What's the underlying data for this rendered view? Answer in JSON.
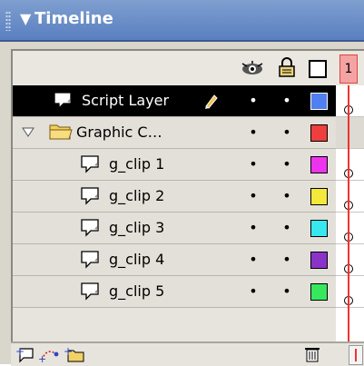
{
  "panel": {
    "title": "Timeline"
  },
  "header": {
    "frame_number": "1"
  },
  "layers": [
    {
      "name": "Script Layer",
      "type": "layer",
      "selected": true,
      "color": "#4f7ff0",
      "has_pencil": true,
      "indent": 1,
      "keyframe": "hollow"
    },
    {
      "name": "Graphic C…",
      "type": "folder",
      "expanded": true,
      "color": "#ee3e3e",
      "indent": 0,
      "keyframe": "none"
    },
    {
      "name": "g_clip 1",
      "type": "layer",
      "color": "#ee33ee",
      "indent": 2,
      "keyframe": "hollow"
    },
    {
      "name": "g_clip 2",
      "type": "layer",
      "color": "#f4e83a",
      "indent": 2,
      "keyframe": "hollow"
    },
    {
      "name": "g_clip 3",
      "type": "layer",
      "color": "#38e8ef",
      "indent": 2,
      "keyframe": "hollow"
    },
    {
      "name": "g_clip 4",
      "type": "layer",
      "color": "#8a33c8",
      "indent": 2,
      "keyframe": "hollow"
    },
    {
      "name": "g_clip 5",
      "type": "layer",
      "color": "#37e85f",
      "indent": 2,
      "keyframe": "hollow"
    }
  ],
  "icons": {
    "eye": "eye-icon",
    "lock": "lock-icon",
    "outline": "outline-square-icon",
    "add_layer": "insert-layer-icon",
    "add_guide": "add-motion-guide-icon",
    "add_folder": "insert-folder-icon",
    "trash": "trash-icon"
  }
}
